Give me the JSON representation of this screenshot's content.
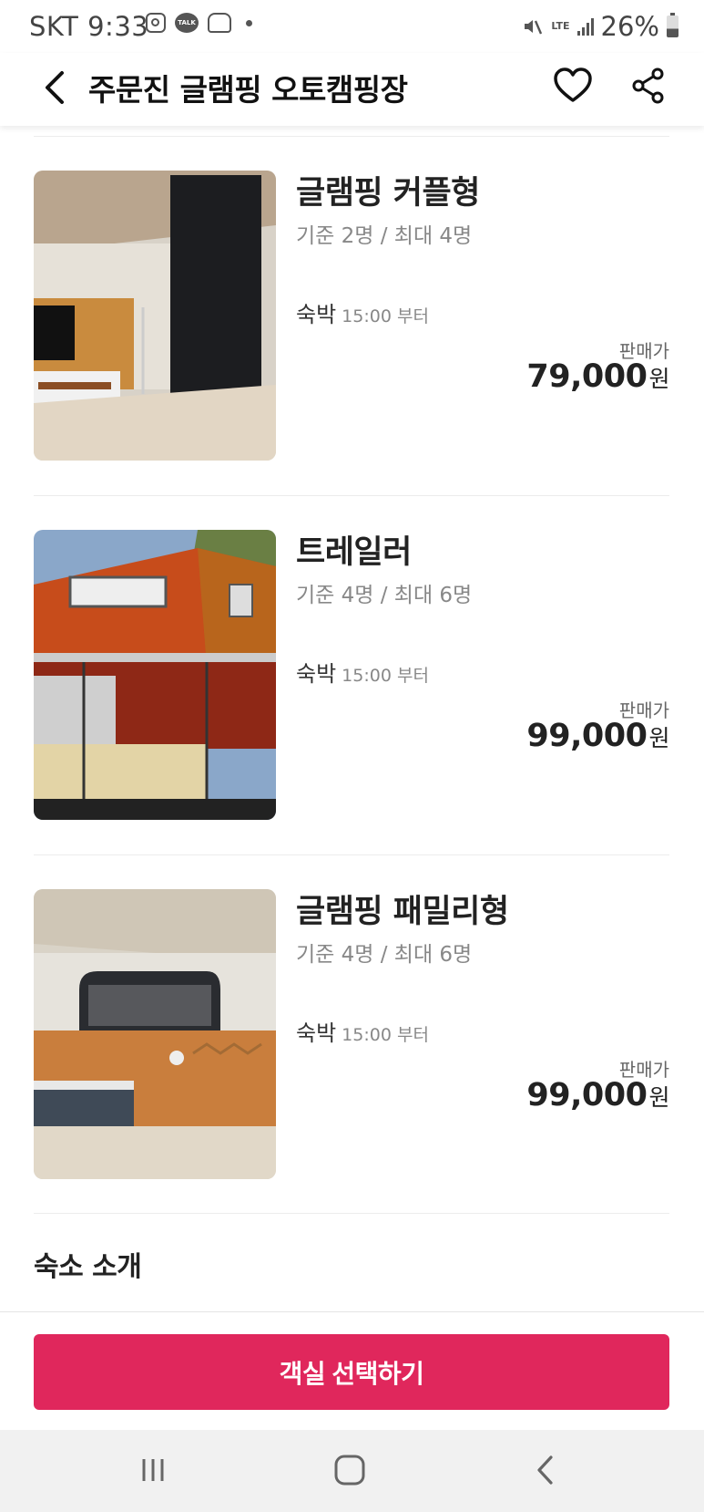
{
  "status_bar": {
    "carrier_time": "SKT 9:33",
    "network": "LTE",
    "battery": "26%"
  },
  "header": {
    "title": "주문진 글램핑 오토캠핑장"
  },
  "rooms": [
    {
      "name": "글램핑 커플형",
      "capacity": "기준 2명 / 최대 4명",
      "stay_label": "숙박",
      "stay_time": "15:00 부터",
      "price_label": "판매가",
      "price": "79,000",
      "currency": "원"
    },
    {
      "name": "트레일러",
      "capacity": "기준 4명 / 최대 6명",
      "stay_label": "숙박",
      "stay_time": "15:00 부터",
      "price_label": "판매가",
      "price": "99,000",
      "currency": "원"
    },
    {
      "name": "글램핑 패밀리형",
      "capacity": "기준 4명 / 최대 6명",
      "stay_label": "숙박",
      "stay_time": "15:00 부터",
      "price_label": "판매가",
      "price": "99,000",
      "currency": "원"
    }
  ],
  "section": {
    "intro_title": "숙소 소개"
  },
  "cta": {
    "label": "객실 선택하기",
    "color": "#e0275c"
  },
  "icons": {
    "header": [
      "back-arrow-icon",
      "heart-icon",
      "share-icon"
    ],
    "navbar": [
      "recent-apps-icon",
      "home-icon",
      "back-icon"
    ]
  }
}
